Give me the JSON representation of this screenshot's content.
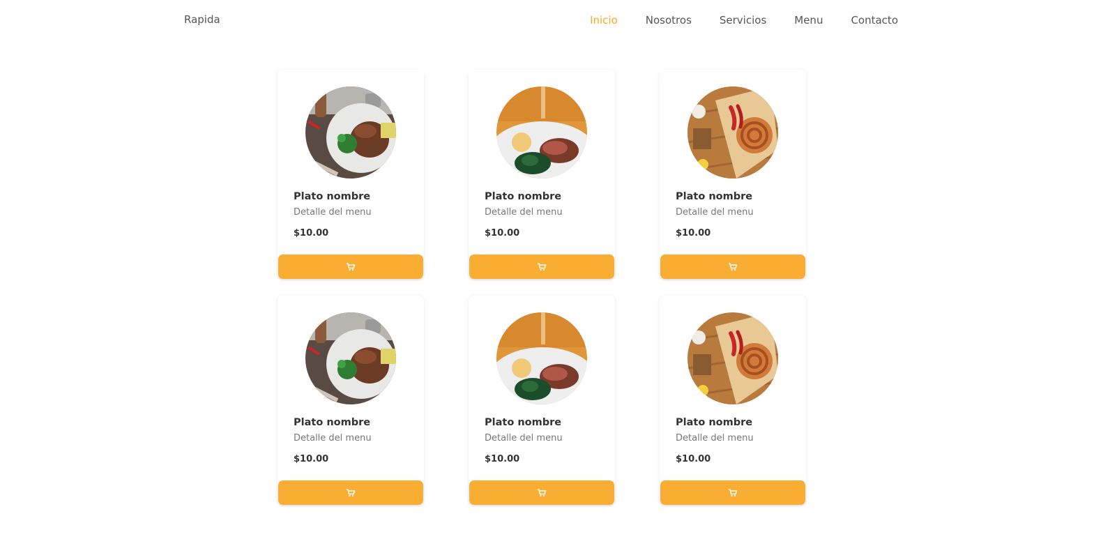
{
  "nav": {
    "brand": "Rapida",
    "links": [
      "Inicio",
      "Nosotros",
      "Servicios",
      "Menu",
      "Contacto"
    ],
    "active_link": "Inicio",
    "accent_color": "#f9a825"
  },
  "cards": [
    {
      "name": "Plato nombre",
      "detail": "Detalle del menu",
      "price": "$10.00",
      "image": "steak-plate-photo"
    },
    {
      "name": "Plato nombre",
      "detail": "Detalle del menu",
      "price": "$10.00",
      "image": "roast-beef-photo"
    },
    {
      "name": "Plato nombre",
      "detail": "Detalle del menu",
      "price": "$10.00",
      "image": "sausage-photo"
    },
    {
      "name": "Plato nombre",
      "detail": "Detalle del menu",
      "price": "$10.00",
      "image": "steak-plate-photo"
    },
    {
      "name": "Plato nombre",
      "detail": "Detalle del menu",
      "price": "$10.00",
      "image": "roast-beef-photo"
    },
    {
      "name": "Plato nombre",
      "detail": "Detalle del menu",
      "price": "$10.00",
      "image": "sausage-photo"
    }
  ],
  "cart_button": {
    "icon": "cart-icon",
    "color": "#f9ae33"
  }
}
